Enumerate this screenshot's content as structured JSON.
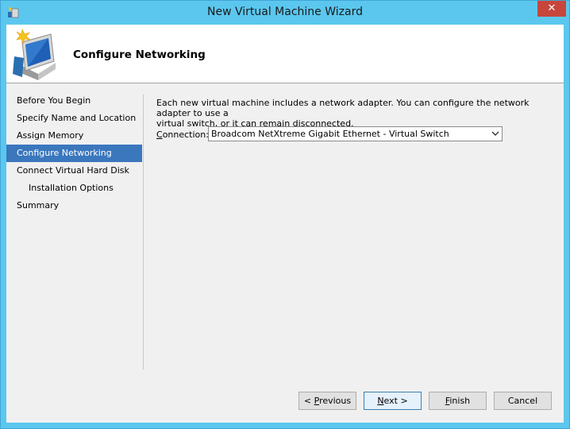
{
  "window": {
    "title": "New Virtual Machine Wizard",
    "close_glyph": "✕",
    "app_icon": "hyper-v-wizard-icon"
  },
  "header": {
    "icon": "virtual-machine-monitor-icon",
    "title": "Configure Networking"
  },
  "nav": {
    "items": [
      {
        "label": "Before You Begin",
        "active": false,
        "indent": false
      },
      {
        "label": "Specify Name and Location",
        "active": false,
        "indent": false
      },
      {
        "label": "Assign Memory",
        "active": false,
        "indent": false
      },
      {
        "label": "Configure Networking",
        "active": true,
        "indent": false
      },
      {
        "label": "Connect Virtual Hard Disk",
        "active": false,
        "indent": false
      },
      {
        "label": "Installation Options",
        "active": false,
        "indent": true
      },
      {
        "label": "Summary",
        "active": false,
        "indent": false
      }
    ]
  },
  "main": {
    "description_line1": "Each new virtual machine includes a network adapter. You can configure the network adapter to use a",
    "description_line2": "virtual switch, or it can remain disconnected.",
    "connection": {
      "label_accel": "C",
      "label_rest": "onnection:",
      "value": "Broadcom NetXtreme Gigabit Ethernet - Virtual Switch",
      "arrow_glyph": "⌄"
    }
  },
  "buttons": {
    "previous": {
      "prefix": "< ",
      "accel": "P",
      "rest": "revious"
    },
    "next": {
      "accel": "N",
      "rest": "ext >"
    },
    "finish": {
      "accel": "F",
      "rest": "inish"
    },
    "cancel": {
      "label": "Cancel"
    }
  },
  "colors": {
    "titlebar": "#5bc7ee",
    "close": "#c7463b",
    "nav_active": "#3b77bd",
    "body": "#f0f0f0"
  }
}
